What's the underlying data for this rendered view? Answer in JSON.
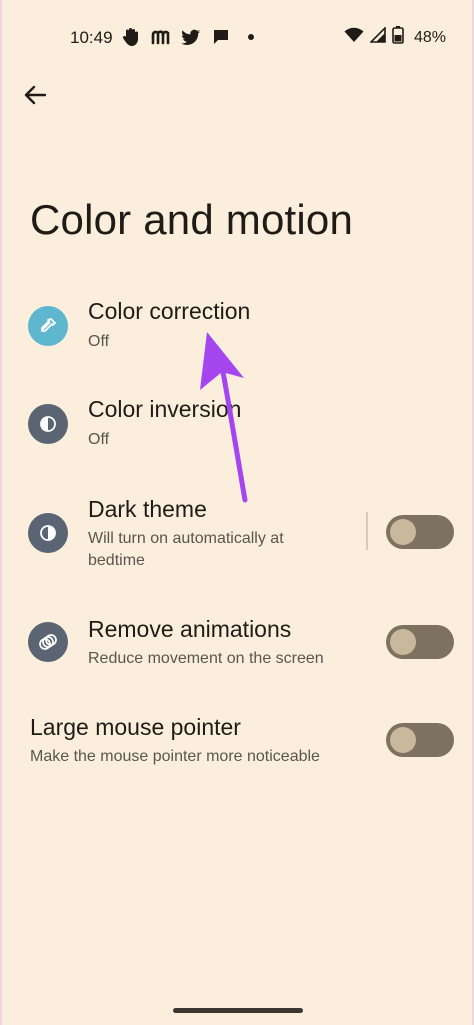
{
  "status": {
    "time": "10:49",
    "battery": "48%"
  },
  "page": {
    "title": "Color and motion"
  },
  "rows": [
    {
      "title": "Color correction",
      "subtitle": "Off",
      "icon": "eyedropper-icon",
      "icon_bg": "#5fb6cf"
    },
    {
      "title": "Color inversion",
      "subtitle": "Off",
      "icon": "inversion-icon",
      "icon_bg": "#5a6472"
    },
    {
      "title": "Dark theme",
      "subtitle": "Will turn on automatically at bedtime",
      "icon": "dark-theme-icon",
      "icon_bg": "#5a6472",
      "toggle_on": false
    },
    {
      "title": "Remove animations",
      "subtitle": "Reduce movement on the screen",
      "icon": "animation-icon",
      "icon_bg": "#5a6472",
      "toggle_on": false
    },
    {
      "title": "Large mouse pointer",
      "subtitle": "Make the mouse pointer more noticeable",
      "toggle_on": false
    }
  ],
  "colors": {
    "background": "#fbeedd",
    "toggle_track": "#7d7260",
    "toggle_knob": "#c8b89c",
    "annotation_arrow": "#a445f0"
  }
}
